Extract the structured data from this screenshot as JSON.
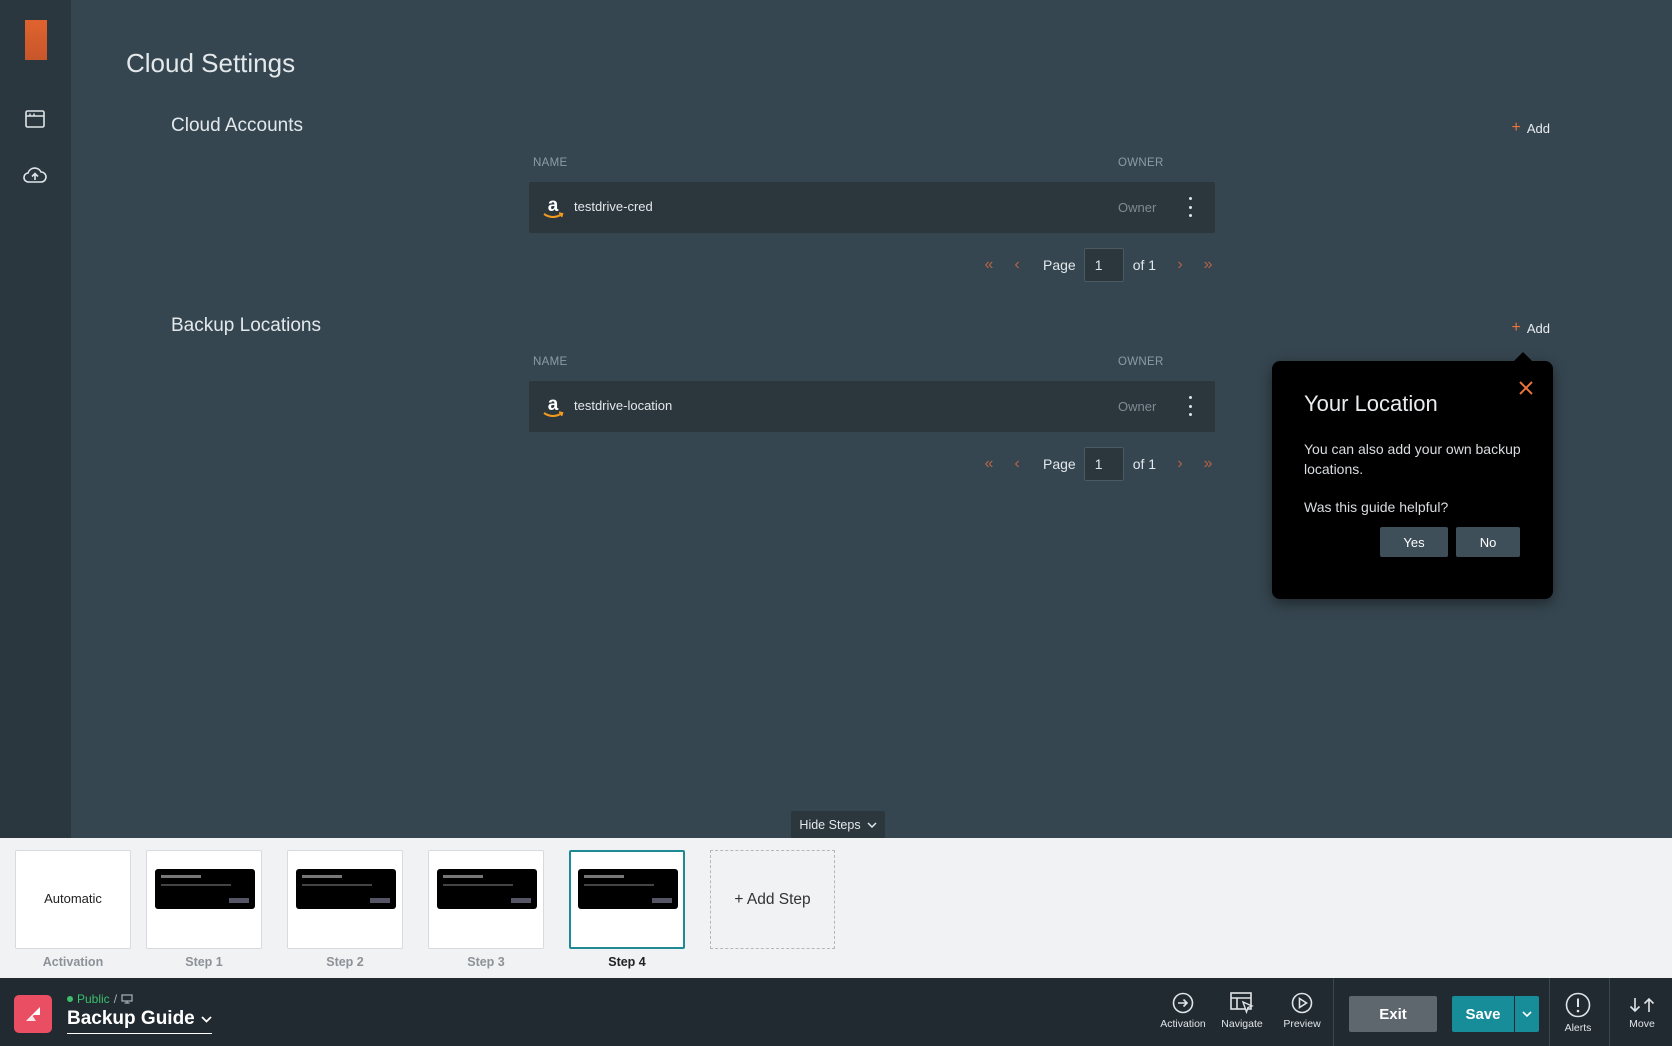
{
  "page": {
    "title": "Cloud Settings"
  },
  "cloud_accounts": {
    "title": "Cloud Accounts",
    "add_label": "Add",
    "columns": {
      "name": "NAME",
      "owner": "OWNER"
    },
    "rows": [
      {
        "name": "testdrive-cred",
        "owner": "Owner"
      }
    ],
    "pager": {
      "label": "Page",
      "current": "1",
      "of": "of 1"
    }
  },
  "backup_locations": {
    "title": "Backup Locations",
    "add_label": "Add",
    "columns": {
      "name": "NAME",
      "owner": "OWNER"
    },
    "rows": [
      {
        "name": "testdrive-location",
        "owner": "Owner"
      }
    ],
    "pager": {
      "label": "Page",
      "current": "1",
      "of": "of 1"
    }
  },
  "tooltip": {
    "title": "Your Location",
    "body": "You can also add your own backup locations.",
    "question": "Was this guide helpful?",
    "yes": "Yes",
    "no": "No"
  },
  "steps": {
    "hide_label": "Hide Steps",
    "activation_inner": "Automatic",
    "items": [
      {
        "label": "Activation"
      },
      {
        "label": "Step 1"
      },
      {
        "label": "Step 2"
      },
      {
        "label": "Step 3"
      },
      {
        "label": "Step 4"
      }
    ],
    "add_step": "+ Add Step"
  },
  "bottom_bar": {
    "status": "Public",
    "guide_name": "Backup Guide",
    "tools": [
      {
        "label": "Activation",
        "icon": "arrow-right-circle-icon"
      },
      {
        "label": "Navigate",
        "icon": "navigate-icon"
      },
      {
        "label": "Preview",
        "icon": "play-circle-icon"
      }
    ],
    "exit": "Exit",
    "save": "Save",
    "alerts": "Alerts",
    "move": "Move"
  },
  "colors": {
    "background": "#364650",
    "sidebar": "#2a373e",
    "accent_orange": "#e8743b",
    "save_teal": "#178d99",
    "active_step": "#1f8a94",
    "public_green": "#3bbf6b",
    "brand_pink": "#e94e63"
  }
}
